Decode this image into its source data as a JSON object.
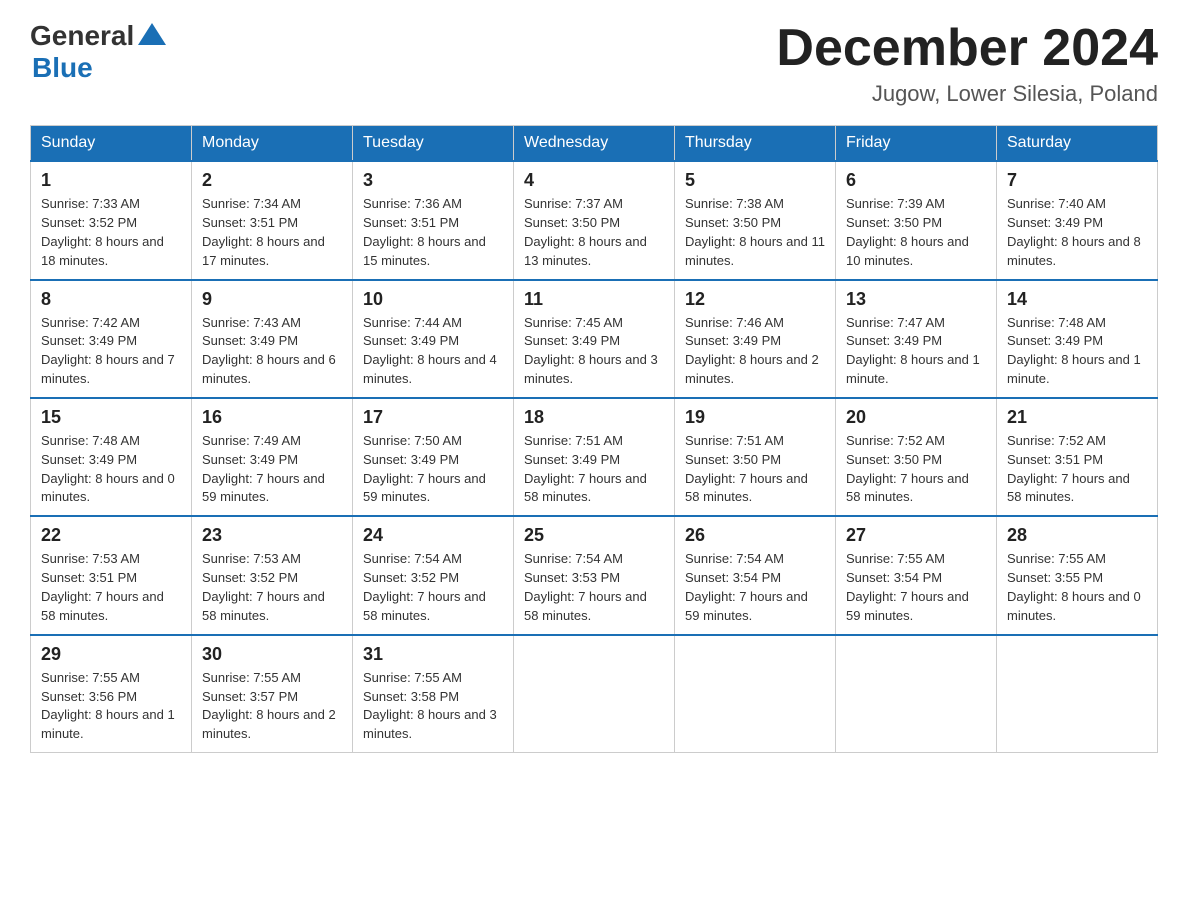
{
  "header": {
    "logo_general": "General",
    "logo_blue": "Blue",
    "month_title": "December 2024",
    "location": "Jugow, Lower Silesia, Poland"
  },
  "days_of_week": [
    "Sunday",
    "Monday",
    "Tuesday",
    "Wednesday",
    "Thursday",
    "Friday",
    "Saturday"
  ],
  "weeks": [
    [
      {
        "day": "1",
        "sunrise": "7:33 AM",
        "sunset": "3:52 PM",
        "daylight": "8 hours and 18 minutes."
      },
      {
        "day": "2",
        "sunrise": "7:34 AM",
        "sunset": "3:51 PM",
        "daylight": "8 hours and 17 minutes."
      },
      {
        "day": "3",
        "sunrise": "7:36 AM",
        "sunset": "3:51 PM",
        "daylight": "8 hours and 15 minutes."
      },
      {
        "day": "4",
        "sunrise": "7:37 AM",
        "sunset": "3:50 PM",
        "daylight": "8 hours and 13 minutes."
      },
      {
        "day": "5",
        "sunrise": "7:38 AM",
        "sunset": "3:50 PM",
        "daylight": "8 hours and 11 minutes."
      },
      {
        "day": "6",
        "sunrise": "7:39 AM",
        "sunset": "3:50 PM",
        "daylight": "8 hours and 10 minutes."
      },
      {
        "day": "7",
        "sunrise": "7:40 AM",
        "sunset": "3:49 PM",
        "daylight": "8 hours and 8 minutes."
      }
    ],
    [
      {
        "day": "8",
        "sunrise": "7:42 AM",
        "sunset": "3:49 PM",
        "daylight": "8 hours and 7 minutes."
      },
      {
        "day": "9",
        "sunrise": "7:43 AM",
        "sunset": "3:49 PM",
        "daylight": "8 hours and 6 minutes."
      },
      {
        "day": "10",
        "sunrise": "7:44 AM",
        "sunset": "3:49 PM",
        "daylight": "8 hours and 4 minutes."
      },
      {
        "day": "11",
        "sunrise": "7:45 AM",
        "sunset": "3:49 PM",
        "daylight": "8 hours and 3 minutes."
      },
      {
        "day": "12",
        "sunrise": "7:46 AM",
        "sunset": "3:49 PM",
        "daylight": "8 hours and 2 minutes."
      },
      {
        "day": "13",
        "sunrise": "7:47 AM",
        "sunset": "3:49 PM",
        "daylight": "8 hours and 1 minute."
      },
      {
        "day": "14",
        "sunrise": "7:48 AM",
        "sunset": "3:49 PM",
        "daylight": "8 hours and 1 minute."
      }
    ],
    [
      {
        "day": "15",
        "sunrise": "7:48 AM",
        "sunset": "3:49 PM",
        "daylight": "8 hours and 0 minutes."
      },
      {
        "day": "16",
        "sunrise": "7:49 AM",
        "sunset": "3:49 PM",
        "daylight": "7 hours and 59 minutes."
      },
      {
        "day": "17",
        "sunrise": "7:50 AM",
        "sunset": "3:49 PM",
        "daylight": "7 hours and 59 minutes."
      },
      {
        "day": "18",
        "sunrise": "7:51 AM",
        "sunset": "3:49 PM",
        "daylight": "7 hours and 58 minutes."
      },
      {
        "day": "19",
        "sunrise": "7:51 AM",
        "sunset": "3:50 PM",
        "daylight": "7 hours and 58 minutes."
      },
      {
        "day": "20",
        "sunrise": "7:52 AM",
        "sunset": "3:50 PM",
        "daylight": "7 hours and 58 minutes."
      },
      {
        "day": "21",
        "sunrise": "7:52 AM",
        "sunset": "3:51 PM",
        "daylight": "7 hours and 58 minutes."
      }
    ],
    [
      {
        "day": "22",
        "sunrise": "7:53 AM",
        "sunset": "3:51 PM",
        "daylight": "7 hours and 58 minutes."
      },
      {
        "day": "23",
        "sunrise": "7:53 AM",
        "sunset": "3:52 PM",
        "daylight": "7 hours and 58 minutes."
      },
      {
        "day": "24",
        "sunrise": "7:54 AM",
        "sunset": "3:52 PM",
        "daylight": "7 hours and 58 minutes."
      },
      {
        "day": "25",
        "sunrise": "7:54 AM",
        "sunset": "3:53 PM",
        "daylight": "7 hours and 58 minutes."
      },
      {
        "day": "26",
        "sunrise": "7:54 AM",
        "sunset": "3:54 PM",
        "daylight": "7 hours and 59 minutes."
      },
      {
        "day": "27",
        "sunrise": "7:55 AM",
        "sunset": "3:54 PM",
        "daylight": "7 hours and 59 minutes."
      },
      {
        "day": "28",
        "sunrise": "7:55 AM",
        "sunset": "3:55 PM",
        "daylight": "8 hours and 0 minutes."
      }
    ],
    [
      {
        "day": "29",
        "sunrise": "7:55 AM",
        "sunset": "3:56 PM",
        "daylight": "8 hours and 1 minute."
      },
      {
        "day": "30",
        "sunrise": "7:55 AM",
        "sunset": "3:57 PM",
        "daylight": "8 hours and 2 minutes."
      },
      {
        "day": "31",
        "sunrise": "7:55 AM",
        "sunset": "3:58 PM",
        "daylight": "8 hours and 3 minutes."
      },
      null,
      null,
      null,
      null
    ]
  ],
  "labels": {
    "sunrise": "Sunrise:",
    "sunset": "Sunset:",
    "daylight": "Daylight:"
  }
}
